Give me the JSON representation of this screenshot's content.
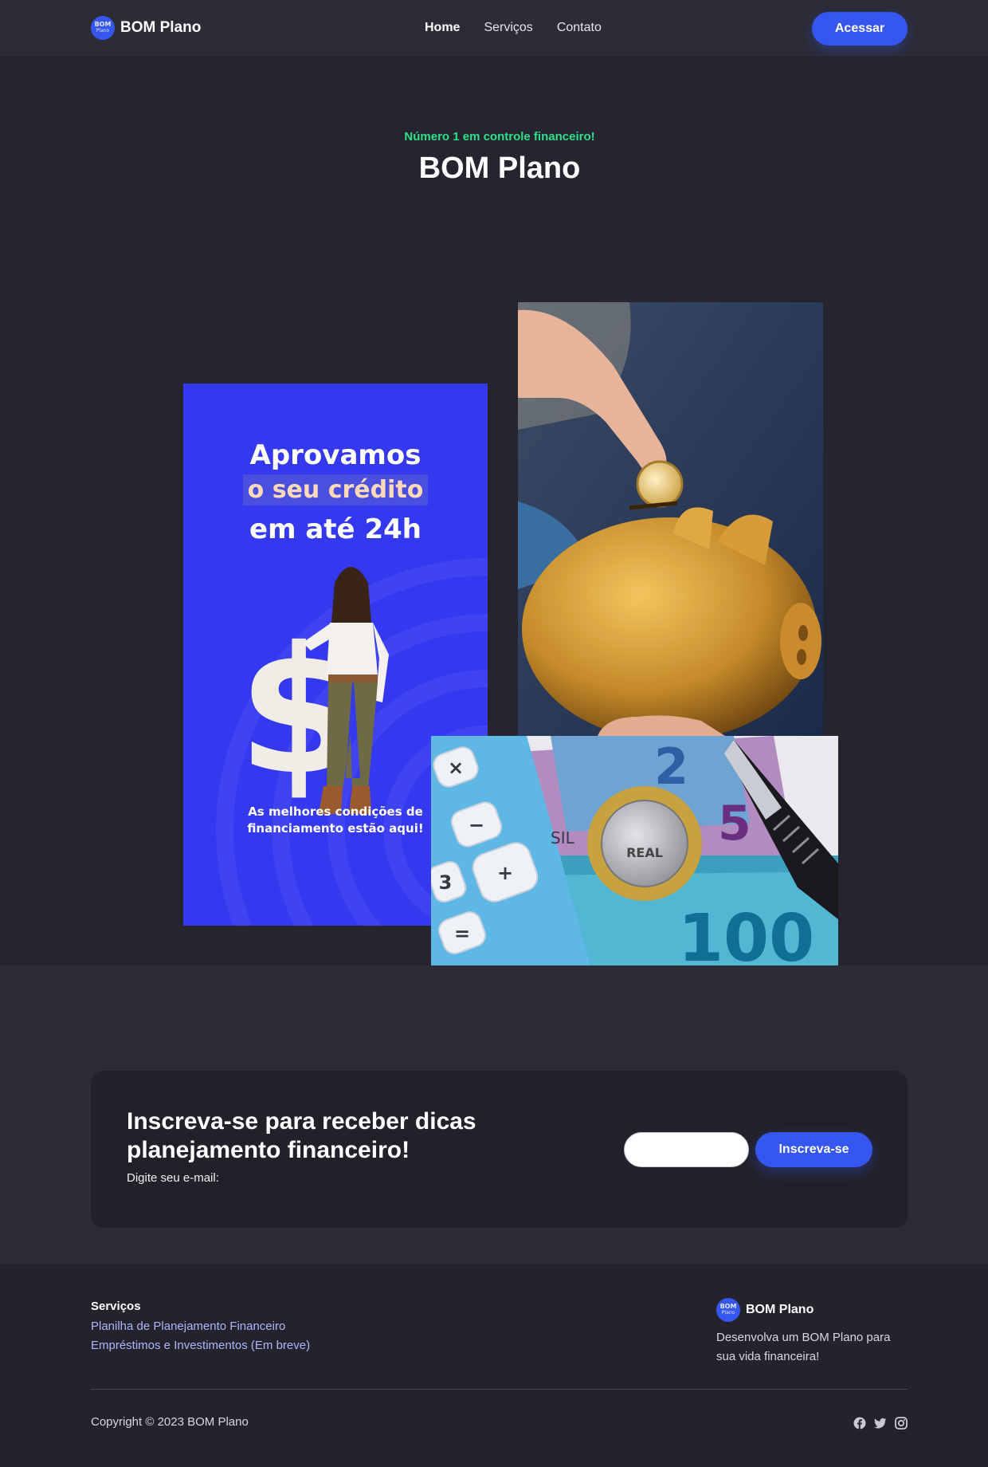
{
  "brand": {
    "badge_line1": "BOM",
    "badge_line2": "Plano",
    "name": "BOM Plano",
    "accent_color": "#3557f0"
  },
  "nav": {
    "items": [
      {
        "label": "Home",
        "active": true
      },
      {
        "label": "Serviços",
        "active": false
      },
      {
        "label": "Contato",
        "active": false
      }
    ],
    "cta_label": "Acessar"
  },
  "hero": {
    "tagline": "Número 1 em controle financeiro!",
    "tagline_color": "#2fe08a",
    "title": "BOM Plano"
  },
  "promo": {
    "line1": "Aprovamos",
    "line2": "o seu crédito",
    "line3": "em até 24h",
    "subtitle_line1": "As melhores condições de",
    "subtitle_line2": "financiamento estão aqui!",
    "background": "#3438ee"
  },
  "money_image": {
    "note_values": [
      "2",
      "5",
      "100"
    ],
    "coin_text": "REAL",
    "banknote_text": "SIL",
    "calculator_keys": [
      "×",
      "−",
      "+",
      "3",
      "="
    ]
  },
  "newsletter": {
    "title": "Inscreva-se para receber dicas planejamento financeiro!",
    "label": "Digite seu e-mail:",
    "input_placeholder": "",
    "button_label": "Inscreva-se"
  },
  "footer": {
    "services_heading": "Serviços",
    "services": [
      "Planilha de Planejamento Financeiro",
      "Empréstimos e Investimentos (Em breve)"
    ],
    "brand_name": "BOM Plano",
    "description": "Desenvolva um BOM Plano para sua vida financeira!",
    "copyright": "Copyright © 2023 BOM Plano",
    "socials": [
      "facebook-icon",
      "twitter-icon",
      "instagram-icon"
    ]
  }
}
